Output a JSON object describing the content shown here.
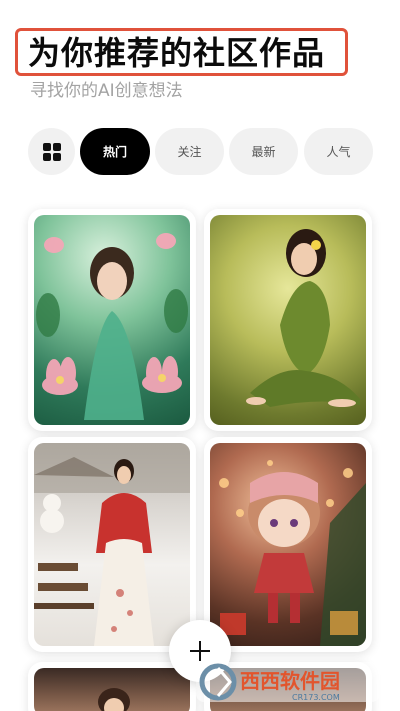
{
  "header": {
    "title": "为你推荐的社区作品",
    "subtitle": "寻找你的AI创意想法"
  },
  "tabs": [
    {
      "label": "热门",
      "active": true
    },
    {
      "label": "关注",
      "active": false
    },
    {
      "label": "最新",
      "active": false
    },
    {
      "label": "人气",
      "active": false
    }
  ],
  "icons": {
    "grid": "grid-view-icon",
    "fab": "plus-icon"
  },
  "feed": [
    {
      "subject": "lotus-girl-teal"
    },
    {
      "subject": "girl-in-green-dress"
    },
    {
      "subject": "girl-in-snow-red-cloak"
    },
    {
      "subject": "christmas-doll-figure"
    },
    {
      "subject": "girl-in-warm-room"
    },
    {
      "subject": "partial-artwork"
    }
  ],
  "colors": {
    "highlight_border": "#e0523b",
    "active_tab": "#000000",
    "inactive_tab": "#f1f1f1"
  },
  "watermark": {
    "brand": "西西软件园",
    "domain": "CR173.COM"
  }
}
